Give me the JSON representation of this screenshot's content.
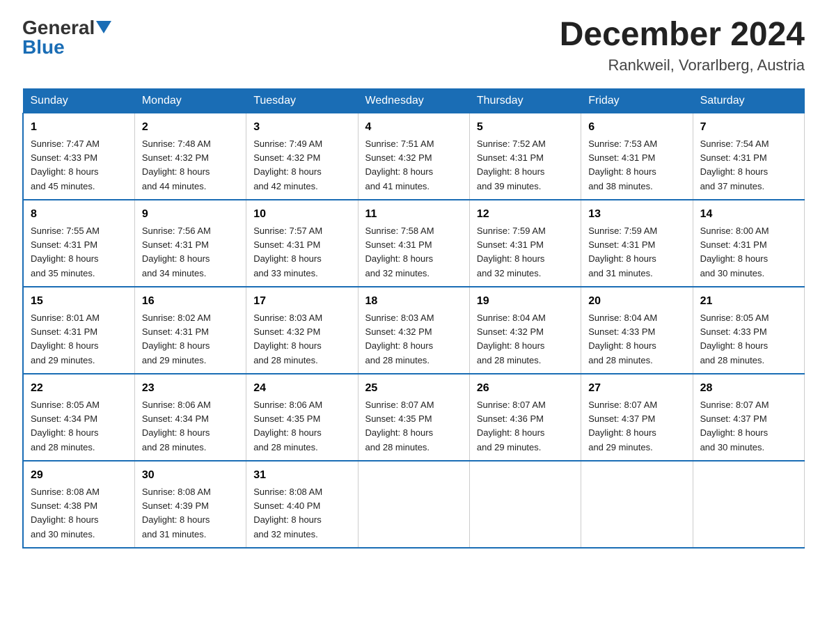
{
  "header": {
    "logo_general": "General",
    "logo_blue": "Blue",
    "month_title": "December 2024",
    "location": "Rankweil, Vorarlberg, Austria"
  },
  "weekdays": [
    "Sunday",
    "Monday",
    "Tuesday",
    "Wednesday",
    "Thursday",
    "Friday",
    "Saturday"
  ],
  "weeks": [
    [
      {
        "day": "1",
        "sunrise": "7:47 AM",
        "sunset": "4:33 PM",
        "daylight": "8 hours and 45 minutes."
      },
      {
        "day": "2",
        "sunrise": "7:48 AM",
        "sunset": "4:32 PM",
        "daylight": "8 hours and 44 minutes."
      },
      {
        "day": "3",
        "sunrise": "7:49 AM",
        "sunset": "4:32 PM",
        "daylight": "8 hours and 42 minutes."
      },
      {
        "day": "4",
        "sunrise": "7:51 AM",
        "sunset": "4:32 PM",
        "daylight": "8 hours and 41 minutes."
      },
      {
        "day": "5",
        "sunrise": "7:52 AM",
        "sunset": "4:31 PM",
        "daylight": "8 hours and 39 minutes."
      },
      {
        "day": "6",
        "sunrise": "7:53 AM",
        "sunset": "4:31 PM",
        "daylight": "8 hours and 38 minutes."
      },
      {
        "day": "7",
        "sunrise": "7:54 AM",
        "sunset": "4:31 PM",
        "daylight": "8 hours and 37 minutes."
      }
    ],
    [
      {
        "day": "8",
        "sunrise": "7:55 AM",
        "sunset": "4:31 PM",
        "daylight": "8 hours and 35 minutes."
      },
      {
        "day": "9",
        "sunrise": "7:56 AM",
        "sunset": "4:31 PM",
        "daylight": "8 hours and 34 minutes."
      },
      {
        "day": "10",
        "sunrise": "7:57 AM",
        "sunset": "4:31 PM",
        "daylight": "8 hours and 33 minutes."
      },
      {
        "day": "11",
        "sunrise": "7:58 AM",
        "sunset": "4:31 PM",
        "daylight": "8 hours and 32 minutes."
      },
      {
        "day": "12",
        "sunrise": "7:59 AM",
        "sunset": "4:31 PM",
        "daylight": "8 hours and 32 minutes."
      },
      {
        "day": "13",
        "sunrise": "7:59 AM",
        "sunset": "4:31 PM",
        "daylight": "8 hours and 31 minutes."
      },
      {
        "day": "14",
        "sunrise": "8:00 AM",
        "sunset": "4:31 PM",
        "daylight": "8 hours and 30 minutes."
      }
    ],
    [
      {
        "day": "15",
        "sunrise": "8:01 AM",
        "sunset": "4:31 PM",
        "daylight": "8 hours and 29 minutes."
      },
      {
        "day": "16",
        "sunrise": "8:02 AM",
        "sunset": "4:31 PM",
        "daylight": "8 hours and 29 minutes."
      },
      {
        "day": "17",
        "sunrise": "8:03 AM",
        "sunset": "4:32 PM",
        "daylight": "8 hours and 28 minutes."
      },
      {
        "day": "18",
        "sunrise": "8:03 AM",
        "sunset": "4:32 PM",
        "daylight": "8 hours and 28 minutes."
      },
      {
        "day": "19",
        "sunrise": "8:04 AM",
        "sunset": "4:32 PM",
        "daylight": "8 hours and 28 minutes."
      },
      {
        "day": "20",
        "sunrise": "8:04 AM",
        "sunset": "4:33 PM",
        "daylight": "8 hours and 28 minutes."
      },
      {
        "day": "21",
        "sunrise": "8:05 AM",
        "sunset": "4:33 PM",
        "daylight": "8 hours and 28 minutes."
      }
    ],
    [
      {
        "day": "22",
        "sunrise": "8:05 AM",
        "sunset": "4:34 PM",
        "daylight": "8 hours and 28 minutes."
      },
      {
        "day": "23",
        "sunrise": "8:06 AM",
        "sunset": "4:34 PM",
        "daylight": "8 hours and 28 minutes."
      },
      {
        "day": "24",
        "sunrise": "8:06 AM",
        "sunset": "4:35 PM",
        "daylight": "8 hours and 28 minutes."
      },
      {
        "day": "25",
        "sunrise": "8:07 AM",
        "sunset": "4:35 PM",
        "daylight": "8 hours and 28 minutes."
      },
      {
        "day": "26",
        "sunrise": "8:07 AM",
        "sunset": "4:36 PM",
        "daylight": "8 hours and 29 minutes."
      },
      {
        "day": "27",
        "sunrise": "8:07 AM",
        "sunset": "4:37 PM",
        "daylight": "8 hours and 29 minutes."
      },
      {
        "day": "28",
        "sunrise": "8:07 AM",
        "sunset": "4:37 PM",
        "daylight": "8 hours and 30 minutes."
      }
    ],
    [
      {
        "day": "29",
        "sunrise": "8:08 AM",
        "sunset": "4:38 PM",
        "daylight": "8 hours and 30 minutes."
      },
      {
        "day": "30",
        "sunrise": "8:08 AM",
        "sunset": "4:39 PM",
        "daylight": "8 hours and 31 minutes."
      },
      {
        "day": "31",
        "sunrise": "8:08 AM",
        "sunset": "4:40 PM",
        "daylight": "8 hours and 32 minutes."
      },
      null,
      null,
      null,
      null
    ]
  ],
  "labels": {
    "sunrise": "Sunrise:",
    "sunset": "Sunset:",
    "daylight": "Daylight:"
  }
}
